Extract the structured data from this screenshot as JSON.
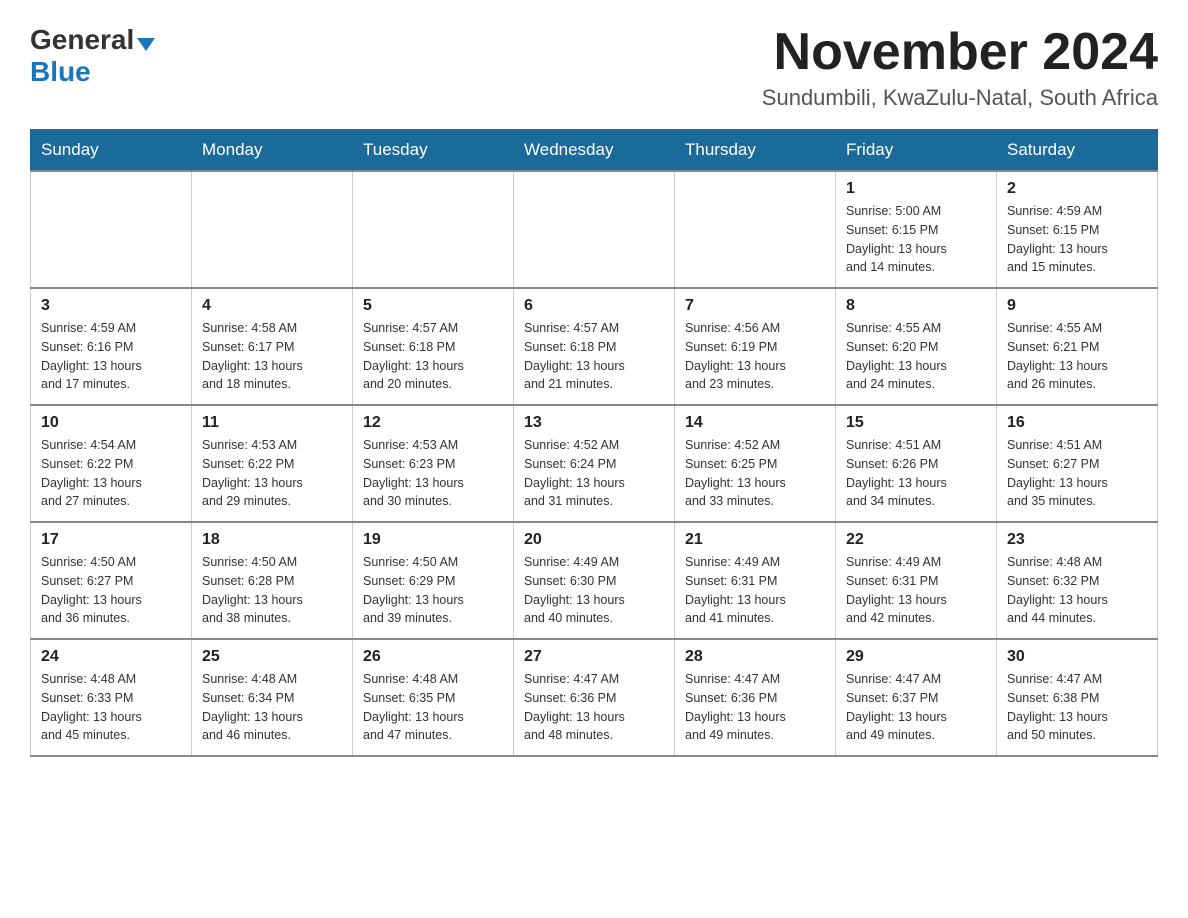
{
  "logo": {
    "general": "General",
    "blue": "Blue"
  },
  "header": {
    "month_title": "November 2024",
    "location": "Sundumbili, KwaZulu-Natal, South Africa"
  },
  "weekdays": [
    "Sunday",
    "Monday",
    "Tuesday",
    "Wednesday",
    "Thursday",
    "Friday",
    "Saturday"
  ],
  "weeks": [
    [
      {
        "day": "",
        "info": ""
      },
      {
        "day": "",
        "info": ""
      },
      {
        "day": "",
        "info": ""
      },
      {
        "day": "",
        "info": ""
      },
      {
        "day": "",
        "info": ""
      },
      {
        "day": "1",
        "info": "Sunrise: 5:00 AM\nSunset: 6:15 PM\nDaylight: 13 hours\nand 14 minutes."
      },
      {
        "day": "2",
        "info": "Sunrise: 4:59 AM\nSunset: 6:15 PM\nDaylight: 13 hours\nand 15 minutes."
      }
    ],
    [
      {
        "day": "3",
        "info": "Sunrise: 4:59 AM\nSunset: 6:16 PM\nDaylight: 13 hours\nand 17 minutes."
      },
      {
        "day": "4",
        "info": "Sunrise: 4:58 AM\nSunset: 6:17 PM\nDaylight: 13 hours\nand 18 minutes."
      },
      {
        "day": "5",
        "info": "Sunrise: 4:57 AM\nSunset: 6:18 PM\nDaylight: 13 hours\nand 20 minutes."
      },
      {
        "day": "6",
        "info": "Sunrise: 4:57 AM\nSunset: 6:18 PM\nDaylight: 13 hours\nand 21 minutes."
      },
      {
        "day": "7",
        "info": "Sunrise: 4:56 AM\nSunset: 6:19 PM\nDaylight: 13 hours\nand 23 minutes."
      },
      {
        "day": "8",
        "info": "Sunrise: 4:55 AM\nSunset: 6:20 PM\nDaylight: 13 hours\nand 24 minutes."
      },
      {
        "day": "9",
        "info": "Sunrise: 4:55 AM\nSunset: 6:21 PM\nDaylight: 13 hours\nand 26 minutes."
      }
    ],
    [
      {
        "day": "10",
        "info": "Sunrise: 4:54 AM\nSunset: 6:22 PM\nDaylight: 13 hours\nand 27 minutes."
      },
      {
        "day": "11",
        "info": "Sunrise: 4:53 AM\nSunset: 6:22 PM\nDaylight: 13 hours\nand 29 minutes."
      },
      {
        "day": "12",
        "info": "Sunrise: 4:53 AM\nSunset: 6:23 PM\nDaylight: 13 hours\nand 30 minutes."
      },
      {
        "day": "13",
        "info": "Sunrise: 4:52 AM\nSunset: 6:24 PM\nDaylight: 13 hours\nand 31 minutes."
      },
      {
        "day": "14",
        "info": "Sunrise: 4:52 AM\nSunset: 6:25 PM\nDaylight: 13 hours\nand 33 minutes."
      },
      {
        "day": "15",
        "info": "Sunrise: 4:51 AM\nSunset: 6:26 PM\nDaylight: 13 hours\nand 34 minutes."
      },
      {
        "day": "16",
        "info": "Sunrise: 4:51 AM\nSunset: 6:27 PM\nDaylight: 13 hours\nand 35 minutes."
      }
    ],
    [
      {
        "day": "17",
        "info": "Sunrise: 4:50 AM\nSunset: 6:27 PM\nDaylight: 13 hours\nand 36 minutes."
      },
      {
        "day": "18",
        "info": "Sunrise: 4:50 AM\nSunset: 6:28 PM\nDaylight: 13 hours\nand 38 minutes."
      },
      {
        "day": "19",
        "info": "Sunrise: 4:50 AM\nSunset: 6:29 PM\nDaylight: 13 hours\nand 39 minutes."
      },
      {
        "day": "20",
        "info": "Sunrise: 4:49 AM\nSunset: 6:30 PM\nDaylight: 13 hours\nand 40 minutes."
      },
      {
        "day": "21",
        "info": "Sunrise: 4:49 AM\nSunset: 6:31 PM\nDaylight: 13 hours\nand 41 minutes."
      },
      {
        "day": "22",
        "info": "Sunrise: 4:49 AM\nSunset: 6:31 PM\nDaylight: 13 hours\nand 42 minutes."
      },
      {
        "day": "23",
        "info": "Sunrise: 4:48 AM\nSunset: 6:32 PM\nDaylight: 13 hours\nand 44 minutes."
      }
    ],
    [
      {
        "day": "24",
        "info": "Sunrise: 4:48 AM\nSunset: 6:33 PM\nDaylight: 13 hours\nand 45 minutes."
      },
      {
        "day": "25",
        "info": "Sunrise: 4:48 AM\nSunset: 6:34 PM\nDaylight: 13 hours\nand 46 minutes."
      },
      {
        "day": "26",
        "info": "Sunrise: 4:48 AM\nSunset: 6:35 PM\nDaylight: 13 hours\nand 47 minutes."
      },
      {
        "day": "27",
        "info": "Sunrise: 4:47 AM\nSunset: 6:36 PM\nDaylight: 13 hours\nand 48 minutes."
      },
      {
        "day": "28",
        "info": "Sunrise: 4:47 AM\nSunset: 6:36 PM\nDaylight: 13 hours\nand 49 minutes."
      },
      {
        "day": "29",
        "info": "Sunrise: 4:47 AM\nSunset: 6:37 PM\nDaylight: 13 hours\nand 49 minutes."
      },
      {
        "day": "30",
        "info": "Sunrise: 4:47 AM\nSunset: 6:38 PM\nDaylight: 13 hours\nand 50 minutes."
      }
    ]
  ]
}
